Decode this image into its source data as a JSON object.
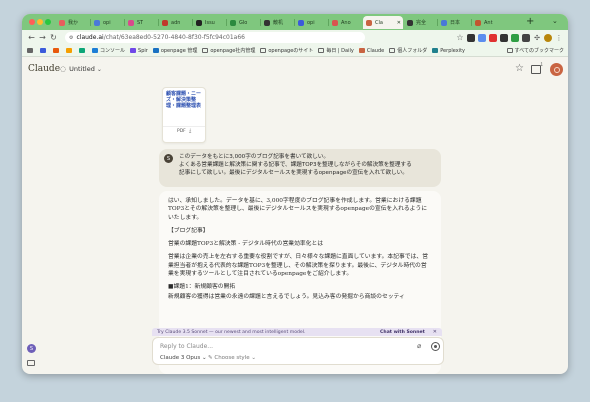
{
  "browser": {
    "tabs": [
      {
        "label": "我か",
        "color": "#e85d5d"
      },
      {
        "label": "opi",
        "color": "#4a79d8"
      },
      {
        "label": "ST",
        "color": "#d94a8c"
      },
      {
        "label": "adn",
        "color": "#c0392b"
      },
      {
        "label": "Issu",
        "color": "#222222"
      },
      {
        "label": "Glo",
        "color": "#2b8a3e"
      },
      {
        "label": "敵机",
        "color": "#333333"
      },
      {
        "label": "opi",
        "color": "#3b5bdb"
      },
      {
        "label": "Ano",
        "color": "#d9534f"
      },
      {
        "label": "Cla",
        "color": "#c96442",
        "active": true
      },
      {
        "label": "完全",
        "color": "#333333"
      },
      {
        "label": "日本",
        "color": "#4a79d8"
      },
      {
        "label": "Ant",
        "color": "#c2572f"
      }
    ],
    "url_host": "claude.ai",
    "url_path": "/chat/63ea8ed0-5270-4840-8f30-f5fc94c01a66",
    "bookmarks": [
      {
        "label": "",
        "type": "apps"
      },
      {
        "label": "",
        "type": "site"
      },
      {
        "label": "",
        "type": "site"
      },
      {
        "label": "",
        "type": "site"
      },
      {
        "label": "",
        "type": "site"
      },
      {
        "label": "コンソール",
        "type": "site"
      },
      {
        "label": "Spir",
        "type": "site"
      },
      {
        "label": "openpage 管理",
        "type": "site"
      },
      {
        "label": "openpage社内管理",
        "type": "folder"
      },
      {
        "label": "openpageのサイト",
        "type": "folder"
      },
      {
        "label": "毎日 | Daily",
        "type": "folder"
      },
      {
        "label": "Claude",
        "type": "site"
      },
      {
        "label": "個人フォルダ",
        "type": "folder"
      },
      {
        "label": "Perplexity",
        "type": "site"
      }
    ],
    "bookmarks_all": "すべてのブックマーク"
  },
  "app": {
    "logo": "Claude",
    "chat_title": "Untitled",
    "project_count": "1"
  },
  "attachment": {
    "title": "顧客課題・ニーズ・解決策整理・課題整理表",
    "type": "PDF"
  },
  "user_message": {
    "avatar_initial": "S",
    "lines": [
      "このデータをもとに3,000字のブログ記事を書いて欲しい。",
      "よくある営業課題と解決策に関する記事で、課題TOP3を整理しながらその解決策を整理する",
      "記事にして欲しい。最後にデジタルセールスを実現するopenpageの宣伝を入れて欲しい。"
    ]
  },
  "assistant": {
    "paragraphs": [
      "はい、承知しました。データを基に、3,000字程度のブログ記事を作成します。営業における課題TOP3とその解決策を整理し、最後にデジタルセールスを実現するopenpageの宣伝を入れるようにいたします。",
      "【ブログ記事】",
      "営業の課題TOP3と解決策 - デジタル時代の営業効率化とは",
      "営業は企業の売上を左右する重要な役割ですが、日々様々な課題に直面しています。本記事では、営業担当者が抱える代表的な課題TOP3を整理し、その解決策を探ります。最後に、デジタル時代の営業を実現するツールとして注目されているopenpageをご紹介します。",
      "■課題1：新規顧客の開拓",
      "新規顧客の獲得は営業の永遠の課題と言えるでしょう。見込み客の発掘から商談のセッティ"
    ]
  },
  "promo": {
    "text": "Try Claude 3.5 Sonnet — our newest and most intelligent model.",
    "button": "Chat with Sonnet",
    "close": "✕"
  },
  "composer": {
    "placeholder": "Reply to Claude...",
    "model": "Claude 3 Opus",
    "style": "Choose style"
  },
  "sidebar": {
    "avatar_initial": "S"
  }
}
